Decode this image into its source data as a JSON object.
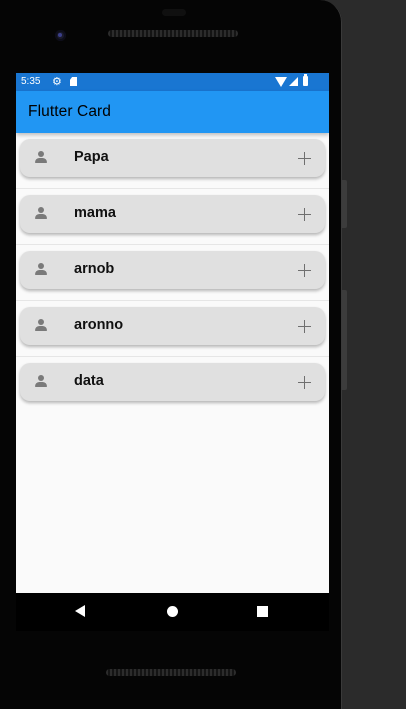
{
  "status_bar": {
    "time": "5:35",
    "settings_icon": "gear-icon",
    "sd_icon": "sd-card-icon",
    "wifi_icon": "wifi-icon",
    "signal_icon": "signal-icon",
    "battery_icon": "battery-icon"
  },
  "app_bar": {
    "title": "Flutter Card"
  },
  "cards": [
    {
      "label": "Papa",
      "leading_icon": "person-icon",
      "trailing_icon": "add-icon"
    },
    {
      "label": "mama",
      "leading_icon": "person-icon",
      "trailing_icon": "add-icon"
    },
    {
      "label": "arnob",
      "leading_icon": "person-icon",
      "trailing_icon": "add-icon"
    },
    {
      "label": "aronno",
      "leading_icon": "person-icon",
      "trailing_icon": "add-icon"
    },
    {
      "label": "data",
      "leading_icon": "person-icon",
      "trailing_icon": "add-icon"
    }
  ],
  "nav_bar": {
    "back_icon": "back-triangle-icon",
    "home_icon": "home-circle-icon",
    "recents_icon": "recents-square-icon"
  },
  "colors": {
    "status_bar": "#1976d2",
    "app_bar": "#2196f3",
    "card": "#e0e0e0",
    "screen_background": "#fafafa",
    "icon_grey": "#7a7a7a"
  }
}
